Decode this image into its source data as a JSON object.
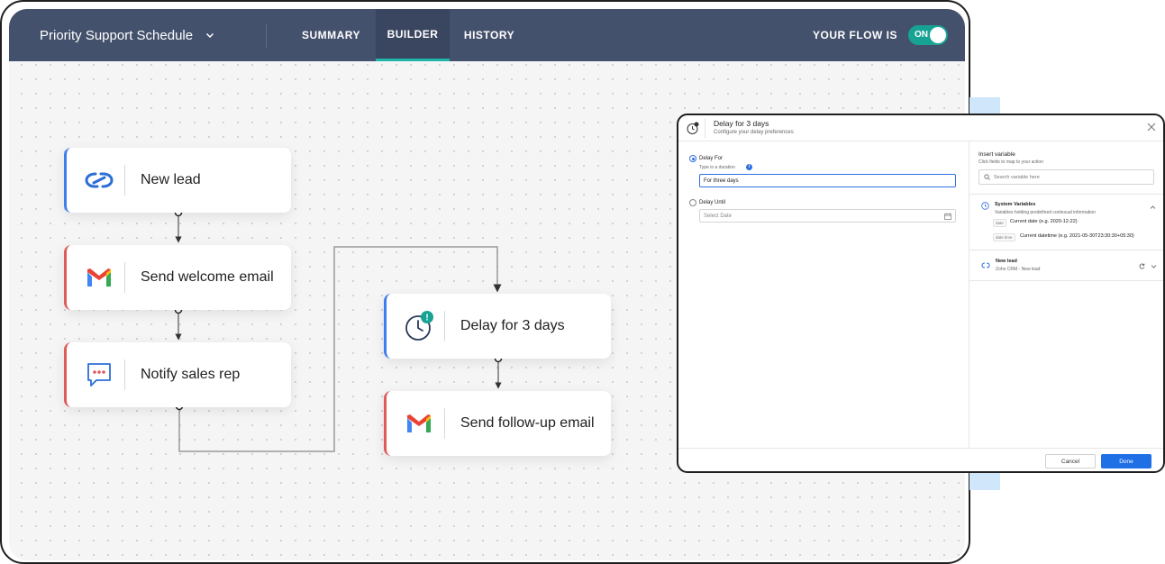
{
  "header": {
    "flow_name": "Priority Support Schedule",
    "tabs": [
      {
        "label": "SUMMARY",
        "active": false
      },
      {
        "label": "BUILDER",
        "active": true
      },
      {
        "label": "HISTORY",
        "active": false
      }
    ],
    "flow_status_label": "YOUR FLOW IS",
    "toggle_text": "ON",
    "toggle_color": "#17a394",
    "accent_color": "#1fb5a9",
    "bar_color": "#44516c"
  },
  "flow": {
    "nodes": [
      {
        "label": "New lead",
        "icon": "zoho-crm-icon"
      },
      {
        "label": "Send welcome email",
        "icon": "gmail-icon"
      },
      {
        "label": "Notify sales rep",
        "icon": "chat-icon"
      },
      {
        "label": "Delay for 3 days",
        "icon": "delay-clock-icon"
      },
      {
        "label": "Send follow-up email",
        "icon": "gmail-icon"
      }
    ]
  },
  "dialog": {
    "title": "Delay for 3 days",
    "subtitle": "Configure your delay preferences",
    "delay_for_label": "Delay For",
    "duration_hint": "Type in a duration",
    "duration_value": "For three days",
    "delay_until_label": "Delay Until",
    "date_placeholder": "Select Date",
    "insert_variable_title": "Insert variable",
    "insert_variable_sub": "Click fields to map to your action",
    "search_placeholder": "Search variable here",
    "system_vars_title": "System Variables",
    "system_vars_sub": "Variables holding predefined contexual information",
    "vars": [
      {
        "tag": "date",
        "text": "Current date (e.g. 2020-12-22)"
      },
      {
        "tag": "date time",
        "text": "Current datetime (e.g. 2021-05-30T23:30:30+05:30)"
      }
    ],
    "new_lead_title": "New lead",
    "new_lead_sub": "Zoho CRM - New lead",
    "cancel_label": "Cancel",
    "done_label": "Done"
  }
}
